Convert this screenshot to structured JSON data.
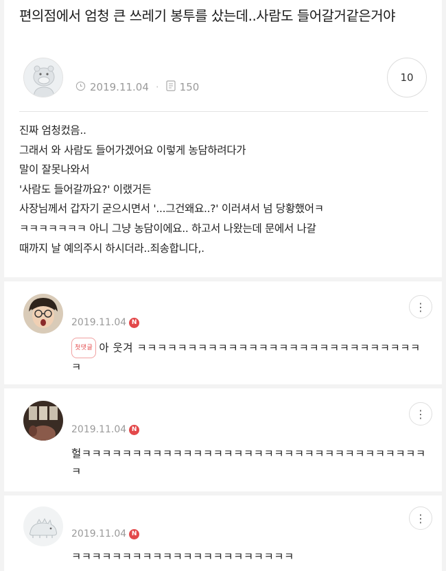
{
  "post": {
    "title": "편의점에서 엄청 큰 쓰레기 봉투를 샀는데..사람도 들어갈거같은거야",
    "date": "2019.11.04",
    "views": "150",
    "comment_count": "10",
    "body_lines": [
      "진짜 엄청컸음..",
      "그래서 와 사람도 들어가겠어요 이렇게 농담하려다가",
      "말이 잘못나와서",
      "'사람도 들어갈까요?' 이랬거든",
      "사장님께서 갑자기 굳으시면서 '...그건왜요..?' 이러셔서 넘 당황했어ㅋ",
      "ㅋㅋㅋㅋㅋㅋㅋ 아니 그냥 농담이에요.. 하고서 나왔는데 문에서 나갈",
      "때까지 날 예의주시 하시더라..죄송합니다,."
    ]
  },
  "comments": [
    {
      "date": "2019.11.04",
      "new_badge": "N",
      "first_badge": "첫댓글",
      "text": "아    웃겨 ㅋㅋㅋㅋㅋㅋㅋㅋㅋㅋㅋㅋㅋㅋㅋㅋㅋㅋㅋㅋㅋㅋㅋㅋㅋㅋㅋㅋㅋ"
    },
    {
      "date": "2019.11.04",
      "new_badge": "N",
      "text": "헐ㅋㅋㅋㅋㅋㅋㅋㅋㅋㅋㅋㅋㅋㅋㅋㅋㅋㅋㅋㅋㅋㅋㅋㅋㅋㅋㅋㅋㅋㅋㅋㅋㅋㅋㅋ"
    },
    {
      "date": "2019.11.04",
      "new_badge": "N",
      "text": "ㅋㅋㅋㅋㅋㅋㅋㅋㅋㅋㅋㅋㅋㅋㅋㅋㅋㅋㅋㅋㅋㅋ"
    }
  ],
  "icons": {
    "clock": "clock-icon",
    "views": "document-icon",
    "more": "more-vertical-icon"
  },
  "colors": {
    "new_badge": "#e3484a",
    "meta_text": "#9a9a9a",
    "background": "#f3f3f3"
  }
}
